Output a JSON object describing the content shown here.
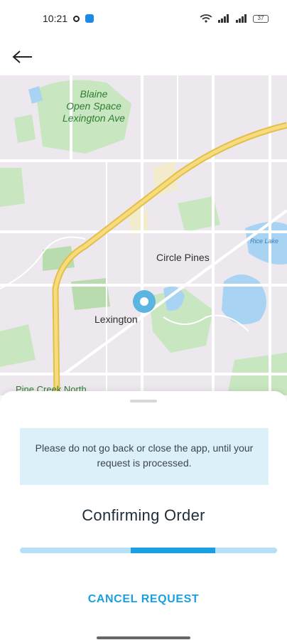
{
  "status_bar": {
    "time": "10:21",
    "battery": "37",
    "icons": [
      "camera-dot-icon",
      "app-badge-icon",
      "wifi-icon",
      "signal-icon",
      "battery-icon"
    ]
  },
  "top_bar": {
    "back_icon": "arrow-left-icon"
  },
  "map": {
    "labels": {
      "park": "Blaine\nOpen Space\nLexington Ave",
      "circle_pines": "Circle Pines",
      "lexington": "Lexington",
      "rice_lake": "Rice Lake",
      "pine_creek": "Pine Creek North"
    },
    "colors": {
      "background": "#ece8ee",
      "park": "#c8e6c0",
      "water": "#a9d3f2",
      "road": "#ffffff",
      "highway": "#f2d36b"
    }
  },
  "sheet": {
    "notice": "Please do not go back or close the app, until your request is processed.",
    "title": "Confirming Order",
    "progress": 0.76,
    "cancel_label": "CANCEL REQUEST",
    "accent": "#1b9fe0"
  }
}
